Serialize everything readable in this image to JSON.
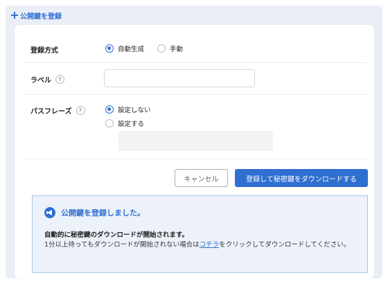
{
  "header": {
    "title": "公開鍵を登録"
  },
  "form": {
    "method": {
      "label": "登録方式",
      "options": [
        "自動生成",
        "手動"
      ],
      "selected": "自動生成"
    },
    "label_field": {
      "label": "ラベル",
      "value": ""
    },
    "passphrase": {
      "label": "パスフレーズ",
      "options": [
        "設定しない",
        "設定する"
      ],
      "selected": "設定しない",
      "value": ""
    }
  },
  "buttons": {
    "cancel": "キャンセル",
    "submit": "登録して秘密鍵をダウンロードする"
  },
  "notice": {
    "title": "公開鍵を登録しました。",
    "bold_text": "自動的に秘密鍵のダウンロードが開始されます。",
    "body_before": "1分以上待ってもダウンロードが開始されない場合は",
    "link_text": "コチラ",
    "body_after": "をクリックしてダウンロードしてください。"
  },
  "colors": {
    "accent": "#2f6fd0",
    "panel_bg": "#eaeef6",
    "notice_bg": "#edf2fa",
    "notice_border": "#a9c2e8"
  },
  "icons": {
    "header": "plus-icon",
    "help": "help-icon",
    "notice": "megaphone-icon"
  }
}
